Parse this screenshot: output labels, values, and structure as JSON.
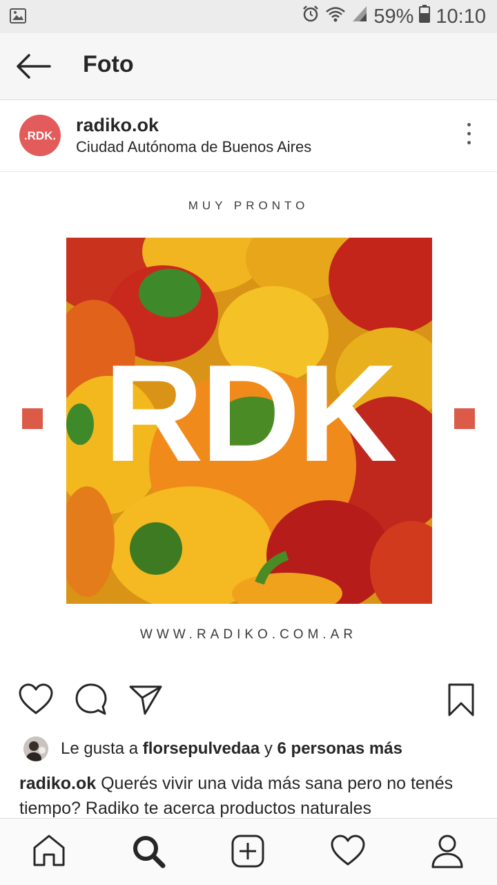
{
  "status_bar": {
    "battery": "59%",
    "time": "10:10",
    "icons": [
      "image-notification-icon",
      "alarm-icon",
      "wifi-icon",
      "signal-icon",
      "battery-icon"
    ]
  },
  "app_bar": {
    "title": "Foto",
    "back_icon": "back-arrow-icon"
  },
  "post": {
    "username": "radiko.ok",
    "location": "Ciudad Autónoma de Buenos Aires",
    "avatar_text": ".RDK.",
    "media": {
      "top_text": "MUY PRONTO",
      "logo": "RDK",
      "bottom_text": "WWW.RADIKO.COM.AR"
    },
    "likes": {
      "prefix": "Le gusta a",
      "user": "florsepulvedaa",
      "joiner": "y",
      "others": "6 personas más"
    },
    "caption": {
      "username": "radiko.ok",
      "text": "Querés vivir una vida más sana pero no tenés tiempo? Radiko te acerca productos naturales"
    }
  },
  "colors": {
    "accent_red": "#db5a48",
    "avatar_bg": "#e35b5b"
  },
  "bottom_nav": [
    "home-icon",
    "search-icon",
    "add-post-icon",
    "activity-heart-icon",
    "profile-icon"
  ]
}
